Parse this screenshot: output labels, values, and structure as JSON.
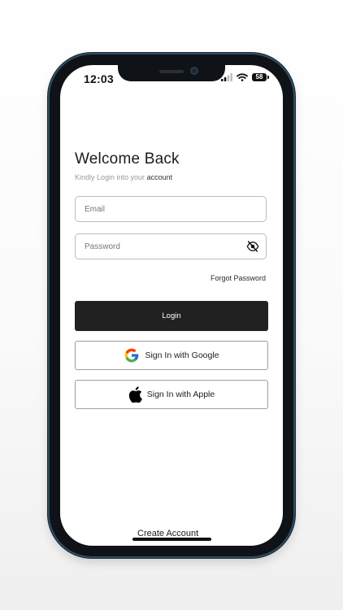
{
  "status_bar": {
    "time": "12:03",
    "battery": "58"
  },
  "login": {
    "title": "Welcome Back",
    "subtitle_prefix": "Kindly Login into your",
    "subtitle_emphasis": "account",
    "email_placeholder": "Email",
    "password_placeholder": "Password",
    "forgot_password": "Forgot Password",
    "login_button": "Login",
    "google_button": "Sign In with Google",
    "apple_button": "Sign In with Apple",
    "create_account": "Create Account"
  },
  "icons": {
    "password_toggle": "eye-off-icon",
    "google": "google-logo-icon",
    "apple": "apple-logo-icon"
  },
  "colors": {
    "primary_button": "#212121",
    "field_border": "#bdbdbd",
    "phone_frame": "#2f4d61"
  }
}
